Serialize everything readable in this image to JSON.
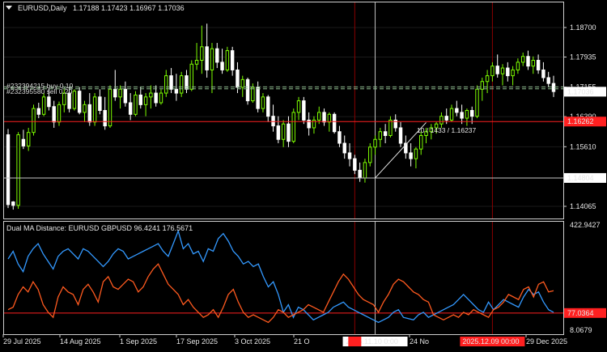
{
  "window": {
    "symbol_title": "EURUSD,Daily",
    "ohlc_readout": "1.17188 1.17423 1.16967 1.17036"
  },
  "orders": [
    {
      "label": "#232394215 buy 0.10"
    },
    {
      "label": "#232395580 sell 0.20"
    }
  ],
  "ruler_text": "10 / 1433 / 1.16237",
  "indicator_title": "Dual MA Distance: EURUSD GBPUSD 96.4241 176.5671",
  "time_axis_labels": [
    "29 Jul 2025",
    "14 Aug 2025",
    "1 Sep 2025",
    "17 Sep 2025",
    "3 Oct 2025",
    "21 O",
    "24 No",
    "29 Dec 2025"
  ],
  "crosshair_time_labels": [
    {
      "text": "2025.11.10 0:00",
      "style": "white"
    },
    {
      "text": "2025.12.09 00:00",
      "style": "red"
    }
  ],
  "colors": {
    "background": "#000000",
    "bull_candle": "#7CFC00",
    "bear_candle": "#FFFFFF",
    "red_line": "#FF2020",
    "dark_red_line": "#8B0000",
    "blue_series": "#3399FF",
    "orange_series": "#FF5A1F",
    "price_tag": "#FFFFFF",
    "order_line": "#8FBC8F"
  },
  "chart_data": [
    {
      "type": "candlestick",
      "title": "EURUSD,Daily",
      "price_ticks": [
        "1.18700",
        "1.17935",
        "1.17155",
        "1.16390",
        "1.15610",
        "1.14804",
        "1.14065"
      ],
      "price_range": [
        1.1375,
        1.1935
      ],
      "current_price": "1.17036",
      "red_level": "1.16262",
      "order_lines": [
        1.1716,
        1.1711
      ],
      "ruler": {
        "from_price": 1.148,
        "to_price": 1.16237,
        "bars": 10
      },
      "candles": [
        {
          "o": 1.1592,
          "h": 1.1607,
          "l": 1.1402,
          "c": 1.1411
        },
        {
          "o": 1.1418,
          "h": 1.142,
          "l": 1.1398,
          "c": 1.1409
        },
        {
          "o": 1.1409,
          "h": 1.1599,
          "l": 1.14,
          "c": 1.1592
        },
        {
          "o": 1.158,
          "h": 1.1605,
          "l": 1.1555,
          "c": 1.1563
        },
        {
          "o": 1.1563,
          "h": 1.161,
          "l": 1.155,
          "c": 1.1598
        },
        {
          "o": 1.1598,
          "h": 1.167,
          "l": 1.159,
          "c": 1.166
        },
        {
          "o": 1.166,
          "h": 1.1675,
          "l": 1.1635,
          "c": 1.1645
        },
        {
          "o": 1.1645,
          "h": 1.17,
          "l": 1.164,
          "c": 1.169
        },
        {
          "o": 1.169,
          "h": 1.1712,
          "l": 1.1655,
          "c": 1.1665
        },
        {
          "o": 1.1665,
          "h": 1.168,
          "l": 1.161,
          "c": 1.1625
        },
        {
          "o": 1.1625,
          "h": 1.1678,
          "l": 1.1615,
          "c": 1.167
        },
        {
          "o": 1.167,
          "h": 1.171,
          "l": 1.165,
          "c": 1.17
        },
        {
          "o": 1.17,
          "h": 1.1715,
          "l": 1.165,
          "c": 1.166
        },
        {
          "o": 1.166,
          "h": 1.171,
          "l": 1.1655,
          "c": 1.1705
        },
        {
          "o": 1.1705,
          "h": 1.1715,
          "l": 1.1645,
          "c": 1.165
        },
        {
          "o": 1.165,
          "h": 1.168,
          "l": 1.1625,
          "c": 1.167
        },
        {
          "o": 1.167,
          "h": 1.17,
          "l": 1.1615,
          "c": 1.1625
        },
        {
          "o": 1.1625,
          "h": 1.17,
          "l": 1.1615,
          "c": 1.169
        },
        {
          "o": 1.169,
          "h": 1.171,
          "l": 1.1645,
          "c": 1.1655
        },
        {
          "o": 1.1655,
          "h": 1.169,
          "l": 1.1605,
          "c": 1.1615
        },
        {
          "o": 1.1615,
          "h": 1.172,
          "l": 1.161,
          "c": 1.171
        },
        {
          "o": 1.171,
          "h": 1.176,
          "l": 1.168,
          "c": 1.169
        },
        {
          "o": 1.169,
          "h": 1.172,
          "l": 1.166,
          "c": 1.171
        },
        {
          "o": 1.171,
          "h": 1.173,
          "l": 1.1665,
          "c": 1.1675
        },
        {
          "o": 1.1675,
          "h": 1.17,
          "l": 1.163,
          "c": 1.1645
        },
        {
          "o": 1.1645,
          "h": 1.1705,
          "l": 1.164,
          "c": 1.1695
        },
        {
          "o": 1.1695,
          "h": 1.1715,
          "l": 1.166,
          "c": 1.167
        },
        {
          "o": 1.167,
          "h": 1.17,
          "l": 1.164,
          "c": 1.169
        },
        {
          "o": 1.169,
          "h": 1.172,
          "l": 1.166,
          "c": 1.17
        },
        {
          "o": 1.17,
          "h": 1.172,
          "l": 1.1665,
          "c": 1.1675
        },
        {
          "o": 1.1675,
          "h": 1.171,
          "l": 1.167,
          "c": 1.17
        },
        {
          "o": 1.17,
          "h": 1.176,
          "l": 1.169,
          "c": 1.1745
        },
        {
          "o": 1.1745,
          "h": 1.1765,
          "l": 1.17,
          "c": 1.171
        },
        {
          "o": 1.171,
          "h": 1.175,
          "l": 1.168,
          "c": 1.17
        },
        {
          "o": 1.17,
          "h": 1.1755,
          "l": 1.169,
          "c": 1.1745
        },
        {
          "o": 1.1745,
          "h": 1.176,
          "l": 1.17,
          "c": 1.171
        },
        {
          "o": 1.171,
          "h": 1.1785,
          "l": 1.1705,
          "c": 1.1775
        },
        {
          "o": 1.1775,
          "h": 1.183,
          "l": 1.176,
          "c": 1.1785
        },
        {
          "o": 1.1785,
          "h": 1.1875,
          "l": 1.175,
          "c": 1.182
        },
        {
          "o": 1.182,
          "h": 1.188,
          "l": 1.174,
          "c": 1.176
        },
        {
          "o": 1.176,
          "h": 1.183,
          "l": 1.17,
          "c": 1.1815
        },
        {
          "o": 1.1815,
          "h": 1.183,
          "l": 1.1765,
          "c": 1.178
        },
        {
          "o": 1.178,
          "h": 1.1815,
          "l": 1.175,
          "c": 1.176
        },
        {
          "o": 1.176,
          "h": 1.182,
          "l": 1.1755,
          "c": 1.181
        },
        {
          "o": 1.181,
          "h": 1.182,
          "l": 1.1745,
          "c": 1.176
        },
        {
          "o": 1.176,
          "h": 1.178,
          "l": 1.17,
          "c": 1.1715
        },
        {
          "o": 1.1715,
          "h": 1.1745,
          "l": 1.169,
          "c": 1.1735
        },
        {
          "o": 1.1735,
          "h": 1.174,
          "l": 1.167,
          "c": 1.168
        },
        {
          "o": 1.168,
          "h": 1.1725,
          "l": 1.1675,
          "c": 1.1715
        },
        {
          "o": 1.1715,
          "h": 1.173,
          "l": 1.165,
          "c": 1.166
        },
        {
          "o": 1.166,
          "h": 1.17,
          "l": 1.165,
          "c": 1.169
        },
        {
          "o": 1.169,
          "h": 1.1695,
          "l": 1.1625,
          "c": 1.164
        },
        {
          "o": 1.164,
          "h": 1.167,
          "l": 1.16,
          "c": 1.1615
        },
        {
          "o": 1.1615,
          "h": 1.164,
          "l": 1.157,
          "c": 1.158
        },
        {
          "o": 1.158,
          "h": 1.163,
          "l": 1.156,
          "c": 1.162
        },
        {
          "o": 1.162,
          "h": 1.164,
          "l": 1.156,
          "c": 1.1575
        },
        {
          "o": 1.1575,
          "h": 1.166,
          "l": 1.157,
          "c": 1.165
        },
        {
          "o": 1.165,
          "h": 1.169,
          "l": 1.163,
          "c": 1.168
        },
        {
          "o": 1.168,
          "h": 1.169,
          "l": 1.162,
          "c": 1.163
        },
        {
          "o": 1.163,
          "h": 1.165,
          "l": 1.159,
          "c": 1.161
        },
        {
          "o": 1.161,
          "h": 1.164,
          "l": 1.1595,
          "c": 1.163
        },
        {
          "o": 1.163,
          "h": 1.1665,
          "l": 1.162,
          "c": 1.165
        },
        {
          "o": 1.165,
          "h": 1.166,
          "l": 1.1615,
          "c": 1.1625
        },
        {
          "o": 1.1625,
          "h": 1.165,
          "l": 1.16,
          "c": 1.1645
        },
        {
          "o": 1.1645,
          "h": 1.165,
          "l": 1.1595,
          "c": 1.16
        },
        {
          "o": 1.16,
          "h": 1.1615,
          "l": 1.156,
          "c": 1.157
        },
        {
          "o": 1.157,
          "h": 1.159,
          "l": 1.153,
          "c": 1.1545
        },
        {
          "o": 1.1545,
          "h": 1.157,
          "l": 1.151,
          "c": 1.153
        },
        {
          "o": 1.153,
          "h": 1.154,
          "l": 1.149,
          "c": 1.15
        },
        {
          "o": 1.15,
          "h": 1.152,
          "l": 1.147,
          "c": 1.148
        },
        {
          "o": 1.148,
          "h": 1.153,
          "l": 1.1468,
          "c": 1.152
        },
        {
          "o": 1.152,
          "h": 1.157,
          "l": 1.151,
          "c": 1.156
        },
        {
          "o": 1.156,
          "h": 1.159,
          "l": 1.154,
          "c": 1.158
        },
        {
          "o": 1.158,
          "h": 1.161,
          "l": 1.156,
          "c": 1.16
        },
        {
          "o": 1.16,
          "h": 1.162,
          "l": 1.157,
          "c": 1.159
        },
        {
          "o": 1.159,
          "h": 1.164,
          "l": 1.1585,
          "c": 1.163
        },
        {
          "o": 1.163,
          "h": 1.1645,
          "l": 1.16,
          "c": 1.161
        },
        {
          "o": 1.161,
          "h": 1.1625,
          "l": 1.156,
          "c": 1.157
        },
        {
          "o": 1.157,
          "h": 1.159,
          "l": 1.153,
          "c": 1.1545
        },
        {
          "o": 1.1545,
          "h": 1.157,
          "l": 1.151,
          "c": 1.153
        },
        {
          "o": 1.153,
          "h": 1.156,
          "l": 1.1505,
          "c": 1.1555
        },
        {
          "o": 1.1555,
          "h": 1.16,
          "l": 1.154,
          "c": 1.159
        },
        {
          "o": 1.159,
          "h": 1.161,
          "l": 1.157,
          "c": 1.16
        },
        {
          "o": 1.16,
          "h": 1.162,
          "l": 1.158,
          "c": 1.161
        },
        {
          "o": 1.161,
          "h": 1.1625,
          "l": 1.1595,
          "c": 1.162
        },
        {
          "o": 1.162,
          "h": 1.165,
          "l": 1.161,
          "c": 1.164
        },
        {
          "o": 1.164,
          "h": 1.166,
          "l": 1.162,
          "c": 1.163
        },
        {
          "o": 1.163,
          "h": 1.167,
          "l": 1.1625,
          "c": 1.166
        },
        {
          "o": 1.166,
          "h": 1.168,
          "l": 1.164,
          "c": 1.165
        },
        {
          "o": 1.165,
          "h": 1.167,
          "l": 1.162,
          "c": 1.1635
        },
        {
          "o": 1.1635,
          "h": 1.166,
          "l": 1.1615,
          "c": 1.1655
        },
        {
          "o": 1.1655,
          "h": 1.1665,
          "l": 1.162,
          "c": 1.164
        },
        {
          "o": 1.164,
          "h": 1.172,
          "l": 1.1635,
          "c": 1.171
        },
        {
          "o": 1.171,
          "h": 1.174,
          "l": 1.168,
          "c": 1.173
        },
        {
          "o": 1.173,
          "h": 1.176,
          "l": 1.17,
          "c": 1.1745
        },
        {
          "o": 1.1745,
          "h": 1.178,
          "l": 1.173,
          "c": 1.177
        },
        {
          "o": 1.177,
          "h": 1.18,
          "l": 1.174,
          "c": 1.175
        },
        {
          "o": 1.175,
          "h": 1.1775,
          "l": 1.172,
          "c": 1.1765
        },
        {
          "o": 1.1765,
          "h": 1.178,
          "l": 1.173,
          "c": 1.1745
        },
        {
          "o": 1.1745,
          "h": 1.177,
          "l": 1.172,
          "c": 1.176
        },
        {
          "o": 1.176,
          "h": 1.179,
          "l": 1.175,
          "c": 1.178
        },
        {
          "o": 1.178,
          "h": 1.1805,
          "l": 1.177,
          "c": 1.1795
        },
        {
          "o": 1.1795,
          "h": 1.181,
          "l": 1.176,
          "c": 1.177
        },
        {
          "o": 1.177,
          "h": 1.1795,
          "l": 1.175,
          "c": 1.1785
        },
        {
          "o": 1.1785,
          "h": 1.18,
          "l": 1.175,
          "c": 1.176
        },
        {
          "o": 1.176,
          "h": 1.178,
          "l": 1.173,
          "c": 1.174
        },
        {
          "o": 1.174,
          "h": 1.1755,
          "l": 1.1715,
          "c": 1.1725
        },
        {
          "o": 1.1725,
          "h": 1.1745,
          "l": 1.169,
          "c": 1.1704
        }
      ]
    },
    {
      "type": "line",
      "title": "Dual MA Distance: EURUSD GBPUSD 96.4241 176.5671",
      "y_ticks": [
        "422.9427",
        "77.0364",
        "8.0679"
      ],
      "y_range": [
        0,
        430
      ],
      "threshold": 77.0364,
      "series": [
        {
          "name": "EURUSD",
          "color": "#3399FF",
          "values": [
            290,
            320,
            270,
            240,
            300,
            330,
            350,
            310,
            280,
            250,
            300,
            320,
            330,
            310,
            290,
            330,
            320,
            300,
            280,
            260,
            280,
            310,
            330,
            320,
            290,
            300,
            310,
            320,
            330,
            340,
            350,
            320,
            300,
            350,
            400,
            330,
            350,
            310,
            320,
            280,
            330,
            320,
            370,
            390,
            360,
            320,
            300,
            270,
            280,
            260,
            270,
            220,
            180,
            200,
            150,
            80,
            110,
            60,
            100,
            90,
            70,
            50,
            60,
            70,
            80,
            100,
            110,
            120,
            100,
            90,
            80,
            70,
            60,
            50,
            40,
            50,
            60,
            80,
            90,
            60,
            55,
            50,
            70,
            80,
            60,
            70,
            80,
            90,
            100,
            110,
            130,
            150,
            130,
            110,
            90,
            80,
            120,
            90,
            110,
            130,
            120,
            110,
            100,
            140,
            170,
            150,
            160,
            120,
            90,
            80
          ]
        },
        {
          "name": "GBPUSD",
          "color": "#FF5A1F",
          "values": [
            90,
            100,
            150,
            180,
            160,
            200,
            170,
            110,
            80,
            60,
            140,
            180,
            160,
            150,
            110,
            170,
            190,
            160,
            120,
            200,
            220,
            180,
            170,
            190,
            210,
            200,
            160,
            180,
            220,
            250,
            270,
            230,
            190,
            170,
            150,
            110,
            130,
            100,
            80,
            60,
            70,
            90,
            60,
            100,
            150,
            170,
            120,
            80,
            60,
            70,
            60,
            50,
            40,
            60,
            90,
            80,
            60,
            70,
            80,
            90,
            110,
            100,
            90,
            80,
            120,
            160,
            200,
            230,
            210,
            180,
            150,
            130,
            120,
            110,
            80,
            120,
            150,
            190,
            210,
            200,
            180,
            160,
            150,
            130,
            120,
            70,
            60,
            50,
            60,
            70,
            60,
            80,
            70,
            90,
            80,
            70,
            60,
            90,
            100,
            120,
            150,
            140,
            130,
            170,
            180,
            140,
            190,
            200,
            160,
            165
          ]
        }
      ]
    }
  ]
}
